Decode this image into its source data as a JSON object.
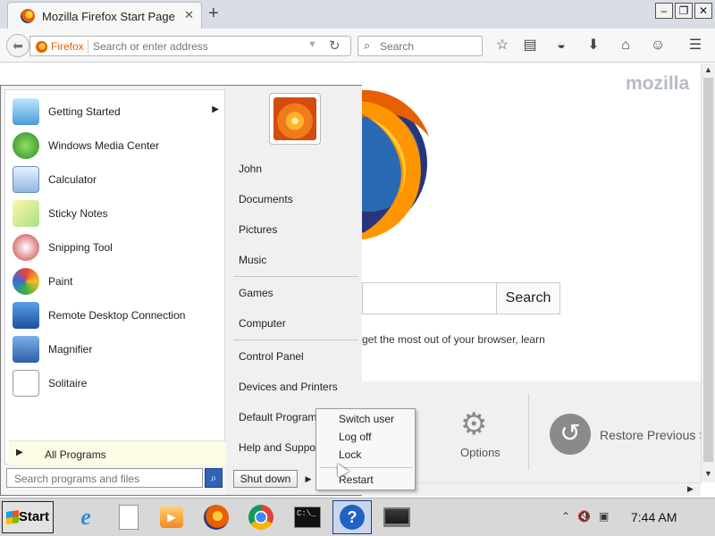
{
  "browser": {
    "tab_title": "Mozilla Firefox Start Page",
    "tab_close": "✕",
    "new_tab": "+",
    "url_identity": "Firefox",
    "url_placeholder": "Search or enter address",
    "search_placeholder": "Search",
    "window_buttons": [
      "–",
      "❐",
      "✕"
    ],
    "accent": "#e66000"
  },
  "page": {
    "brand": "mozilla",
    "search_button": "Search",
    "hint": "get the most out of your browser, learn",
    "options_label": "Options",
    "restore_label": "Restore Previous S"
  },
  "start_menu": {
    "programs": [
      {
        "label": "Getting Started",
        "icon": "getting-started-icon",
        "has_submenu": true
      },
      {
        "label": "Windows Media Center",
        "icon": "media-center-icon"
      },
      {
        "label": "Calculator",
        "icon": "calculator-icon"
      },
      {
        "label": "Sticky Notes",
        "icon": "sticky-notes-icon"
      },
      {
        "label": "Snipping Tool",
        "icon": "snipping-tool-icon"
      },
      {
        "label": "Paint",
        "icon": "paint-icon"
      },
      {
        "label": "Remote Desktop Connection",
        "icon": "remote-desktop-icon"
      },
      {
        "label": "Magnifier",
        "icon": "magnifier-icon"
      },
      {
        "label": "Solitaire",
        "icon": "solitaire-icon"
      }
    ],
    "all_programs": "All Programs",
    "search_placeholder": "Search programs and files",
    "right_links": [
      "John",
      "Documents",
      "Pictures",
      "Music",
      "Games",
      "Computer",
      "Control Panel",
      "Devices and Printers",
      "Default Programs",
      "Help and Support"
    ],
    "shutdown": "Shut down",
    "power_options": [
      "Switch user",
      "Log off",
      "Lock",
      "Restart"
    ]
  },
  "taskbar": {
    "start_label": "Start",
    "clock": "7:44 AM"
  }
}
